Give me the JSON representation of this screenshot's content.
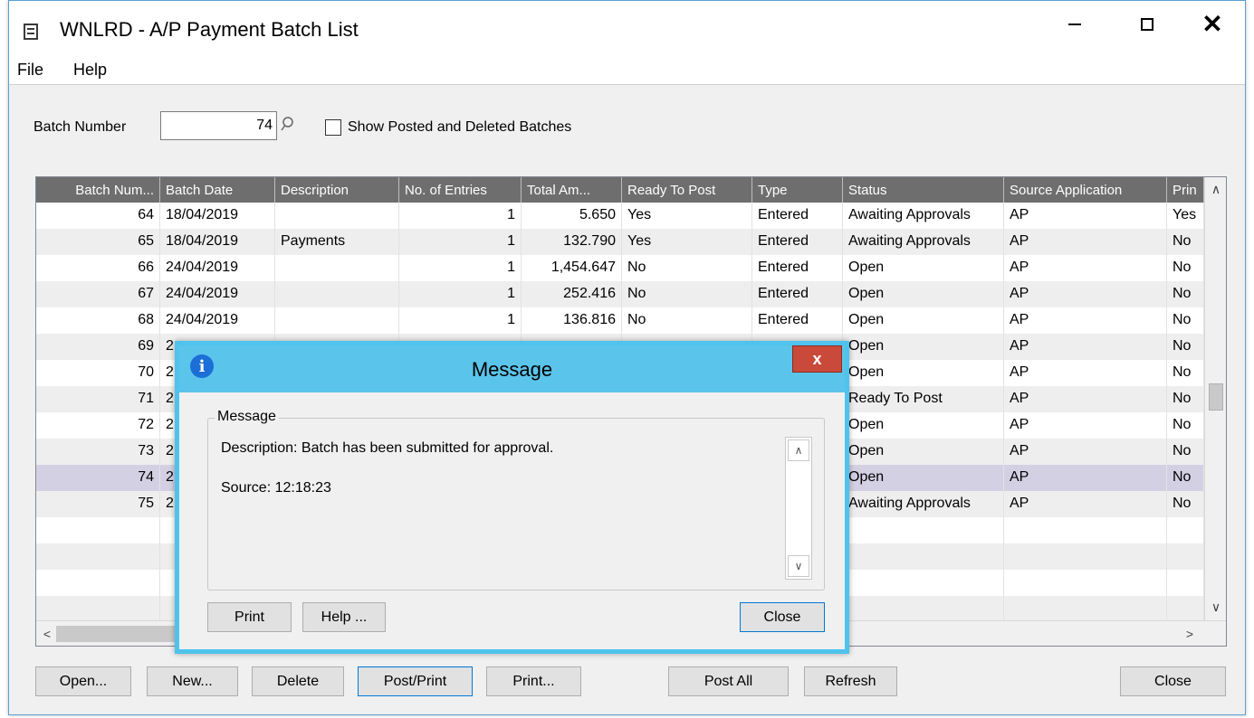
{
  "window": {
    "title": "WNLRD - A/P Payment Batch List",
    "minimize": "—",
    "close": "✕"
  },
  "menu": [
    "File",
    "Help"
  ],
  "filter": {
    "batch_label": "Batch Number",
    "batch_value": "74",
    "show_posted_label": "Show Posted and Deleted Batches",
    "show_posted_checked": false
  },
  "grid": {
    "columns": [
      "Batch Num...",
      "Batch Date",
      "Description",
      "No. of Entries",
      "Total Am...",
      "Ready To Post",
      "Type",
      "Status",
      "Source Application",
      "Prin"
    ],
    "rows": [
      {
        "num": "64",
        "date": "18/04/2019",
        "desc": "",
        "entries": "1",
        "total": "5.650",
        "ready": "Yes",
        "type": "Entered",
        "status": "Awaiting Approvals",
        "source": "AP",
        "printed": "Yes"
      },
      {
        "num": "65",
        "date": "18/04/2019",
        "desc": "Payments",
        "entries": "1",
        "total": "132.790",
        "ready": "Yes",
        "type": "Entered",
        "status": "Awaiting Approvals",
        "source": "AP",
        "printed": "No"
      },
      {
        "num": "66",
        "date": "24/04/2019",
        "desc": "",
        "entries": "1",
        "total": "1,454.647",
        "ready": "No",
        "type": "Entered",
        "status": "Open",
        "source": "AP",
        "printed": "No"
      },
      {
        "num": "67",
        "date": "24/04/2019",
        "desc": "",
        "entries": "1",
        "total": "252.416",
        "ready": "No",
        "type": "Entered",
        "status": "Open",
        "source": "AP",
        "printed": "No"
      },
      {
        "num": "68",
        "date": "24/04/2019",
        "desc": "",
        "entries": "1",
        "total": "136.816",
        "ready": "No",
        "type": "Entered",
        "status": "Open",
        "source": "AP",
        "printed": "No"
      },
      {
        "num": "69",
        "date": "2",
        "desc": "",
        "entries": "",
        "total": "",
        "ready": "",
        "type": "",
        "status": "Open",
        "source": "AP",
        "printed": "No"
      },
      {
        "num": "70",
        "date": "2",
        "desc": "",
        "entries": "",
        "total": "",
        "ready": "",
        "type": "",
        "status": "Open",
        "source": "AP",
        "printed": "No"
      },
      {
        "num": "71",
        "date": "2",
        "desc": "",
        "entries": "",
        "total": "",
        "ready": "",
        "type": "",
        "status": "Ready To Post",
        "source": "AP",
        "printed": "No"
      },
      {
        "num": "72",
        "date": "2",
        "desc": "",
        "entries": "",
        "total": "",
        "ready": "",
        "type": "",
        "status": "Open",
        "source": "AP",
        "printed": "No"
      },
      {
        "num": "73",
        "date": "2",
        "desc": "",
        "entries": "",
        "total": "",
        "ready": "",
        "type": "",
        "status": "Open",
        "source": "AP",
        "printed": "No"
      },
      {
        "num": "74",
        "date": "2",
        "desc": "",
        "entries": "",
        "total": "",
        "ready": "",
        "type": "",
        "status": "Open",
        "source": "AP",
        "printed": "No"
      },
      {
        "num": "75",
        "date": "2",
        "desc": "",
        "entries": "",
        "total": "",
        "ready": "",
        "type": "",
        "status": "Awaiting Approvals",
        "source": "AP",
        "printed": "No"
      }
    ],
    "selected_row": 10
  },
  "buttons": {
    "open": "Open...",
    "new": "New...",
    "delete": "Delete",
    "post_print": "Post/Print",
    "print": "Print...",
    "post_all": "Post All",
    "refresh": "Refresh",
    "close": "Close"
  },
  "dialog": {
    "title": "Message",
    "info_icon": "i",
    "close_glyph": "x",
    "group_label": "Message",
    "description": "Description: Batch has been submitted for approval.",
    "source": "Source:  12:18:23",
    "print": "Print",
    "help": "Help ...",
    "close": "Close"
  },
  "colors": {
    "dialog_border": "#4fc3ec",
    "dialog_close": "#c94a3a",
    "grid_header": "#6e6e6e",
    "selected_row": "#d4d0e4"
  }
}
